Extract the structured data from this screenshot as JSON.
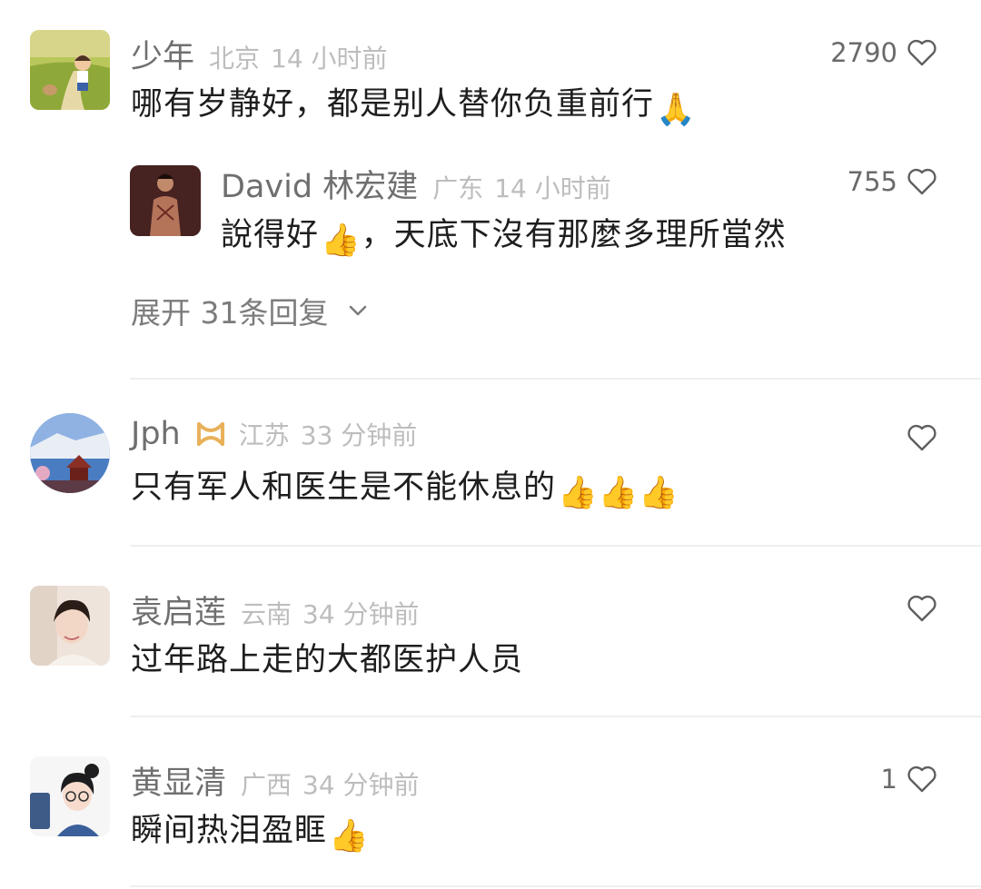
{
  "comments": [
    {
      "user": "少年",
      "location": "北京",
      "time": "14 小时前",
      "text": "哪有岁静好，都是别人替你负重前行",
      "emoji": "🙏",
      "likes": "2790",
      "reply": {
        "user": "David 林宏建",
        "location": "广东",
        "time": "14 小时前",
        "text_before": "說得好",
        "emoji": "👍",
        "text_after": "，天底下沒有那麼多理所當然",
        "likes": "755"
      },
      "expand_label": "展开 31条回复"
    },
    {
      "user": "Jph",
      "badge_icon": "gold-ribbon-badge-icon",
      "location": "江苏",
      "time": "33 分钟前",
      "text": "只有军人和医生是不能休息的",
      "emoji": "👍👍👍",
      "likes": ""
    },
    {
      "user": "袁启莲",
      "location": "云南",
      "time": "34 分钟前",
      "text": "过年路上走的大都医护人员",
      "emoji": "",
      "likes": ""
    },
    {
      "user": "黄显清",
      "location": "广西",
      "time": "34 分钟前",
      "text": "瞬间热泪盈眶",
      "emoji": "👍",
      "likes": "1"
    }
  ],
  "colors": {
    "username": "#6f6f6f",
    "meta": "#bdbdbd",
    "text": "#1e1e1e",
    "divider": "#efefef",
    "badge": "#e8b15a"
  }
}
